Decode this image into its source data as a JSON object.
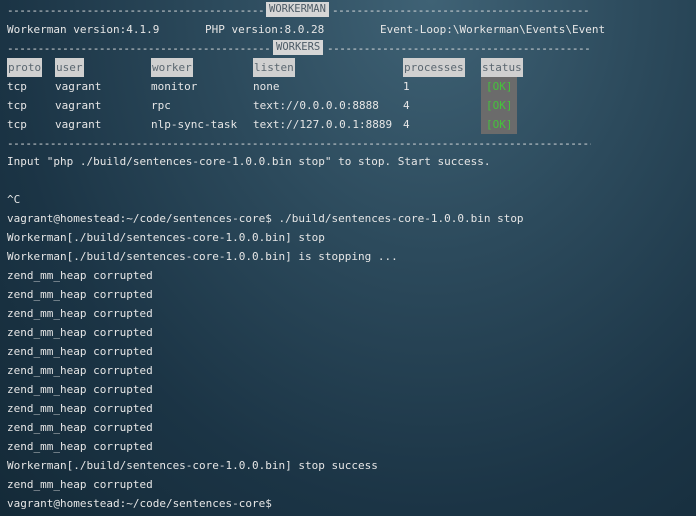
{
  "separators": {
    "top_left": "--------------------------------------------------------------",
    "top_right": "--------------------------------------------------------------------------",
    "mid_left": "------------------------------------------------------------------",
    "mid_right": "------------------------------------------------------------------------",
    "bottom": "------------------------------------------------------------------------------------------------------------------------------------------------"
  },
  "banner": {
    "workerman": "WORKERMAN",
    "workers": "WORKERS"
  },
  "info": {
    "workerman_version": "Workerman version:4.1.9",
    "php_version": "PHP version:8.0.28",
    "event_loop": "Event-Loop:\\Workerman\\Events\\Event"
  },
  "table": {
    "headers": [
      "proto",
      "user",
      "worker",
      "listen",
      "processes",
      "status"
    ],
    "rows": [
      {
        "proto": "tcp",
        "user": "vagrant",
        "worker": "monitor",
        "listen": "none",
        "processes": "1",
        "status": "[OK]"
      },
      {
        "proto": "tcp",
        "user": "vagrant",
        "worker": "rpc",
        "listen": "text://0.0.0.0:8888",
        "processes": "4",
        "status": "[OK]"
      },
      {
        "proto": "tcp",
        "user": "vagrant",
        "worker": "nlp-sync-task",
        "listen": "text://127.0.0.1:8889",
        "processes": "4",
        "status": "[OK]"
      }
    ]
  },
  "output": [
    "Input \"php ./build/sentences-core-1.0.0.bin stop\" to stop. Start success.",
    "",
    "^C",
    "vagrant@homestead:~/code/sentences-core$ ./build/sentences-core-1.0.0.bin stop",
    "Workerman[./build/sentences-core-1.0.0.bin] stop",
    "Workerman[./build/sentences-core-1.0.0.bin] is stopping ...",
    "zend_mm_heap corrupted",
    "zend_mm_heap corrupted",
    "zend_mm_heap corrupted",
    "zend_mm_heap corrupted",
    "zend_mm_heap corrupted",
    "zend_mm_heap corrupted",
    "zend_mm_heap corrupted",
    "zend_mm_heap corrupted",
    "zend_mm_heap corrupted",
    "zend_mm_heap corrupted",
    "Workerman[./build/sentences-core-1.0.0.bin] stop success",
    "zend_mm_heap corrupted",
    "vagrant@homestead:~/code/sentences-core$"
  ],
  "colors": {
    "ok": "#45c23c",
    "header_bg": "#d0d0d0",
    "status_bg": "#6b6b6b"
  }
}
